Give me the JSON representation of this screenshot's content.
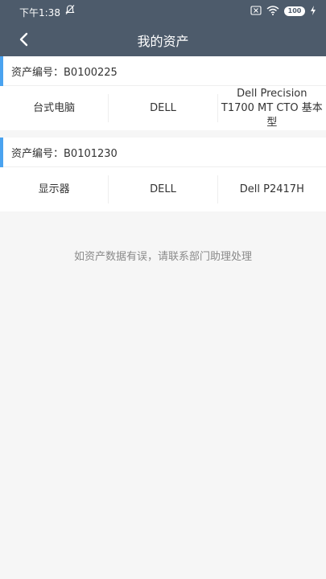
{
  "status_bar": {
    "time": "下午1:38",
    "battery": "100"
  },
  "header": {
    "title": "我的资产"
  },
  "assets": [
    {
      "code_label": "资产编号：B0100225",
      "type": "台式电脑",
      "brand": "DELL",
      "model": "Dell Precision T1700 MT CTO 基本型"
    },
    {
      "code_label": "资产编号：B0101230",
      "type": "显示器",
      "brand": "DELL",
      "model": "Dell P2417H"
    }
  ],
  "footer": {
    "hint": "如资产数据有误，请联系部门助理处理"
  },
  "colors": {
    "header_bg": "#4d5b6b",
    "accent": "#4aa3f0",
    "page_bg": "#f6f6f6"
  }
}
